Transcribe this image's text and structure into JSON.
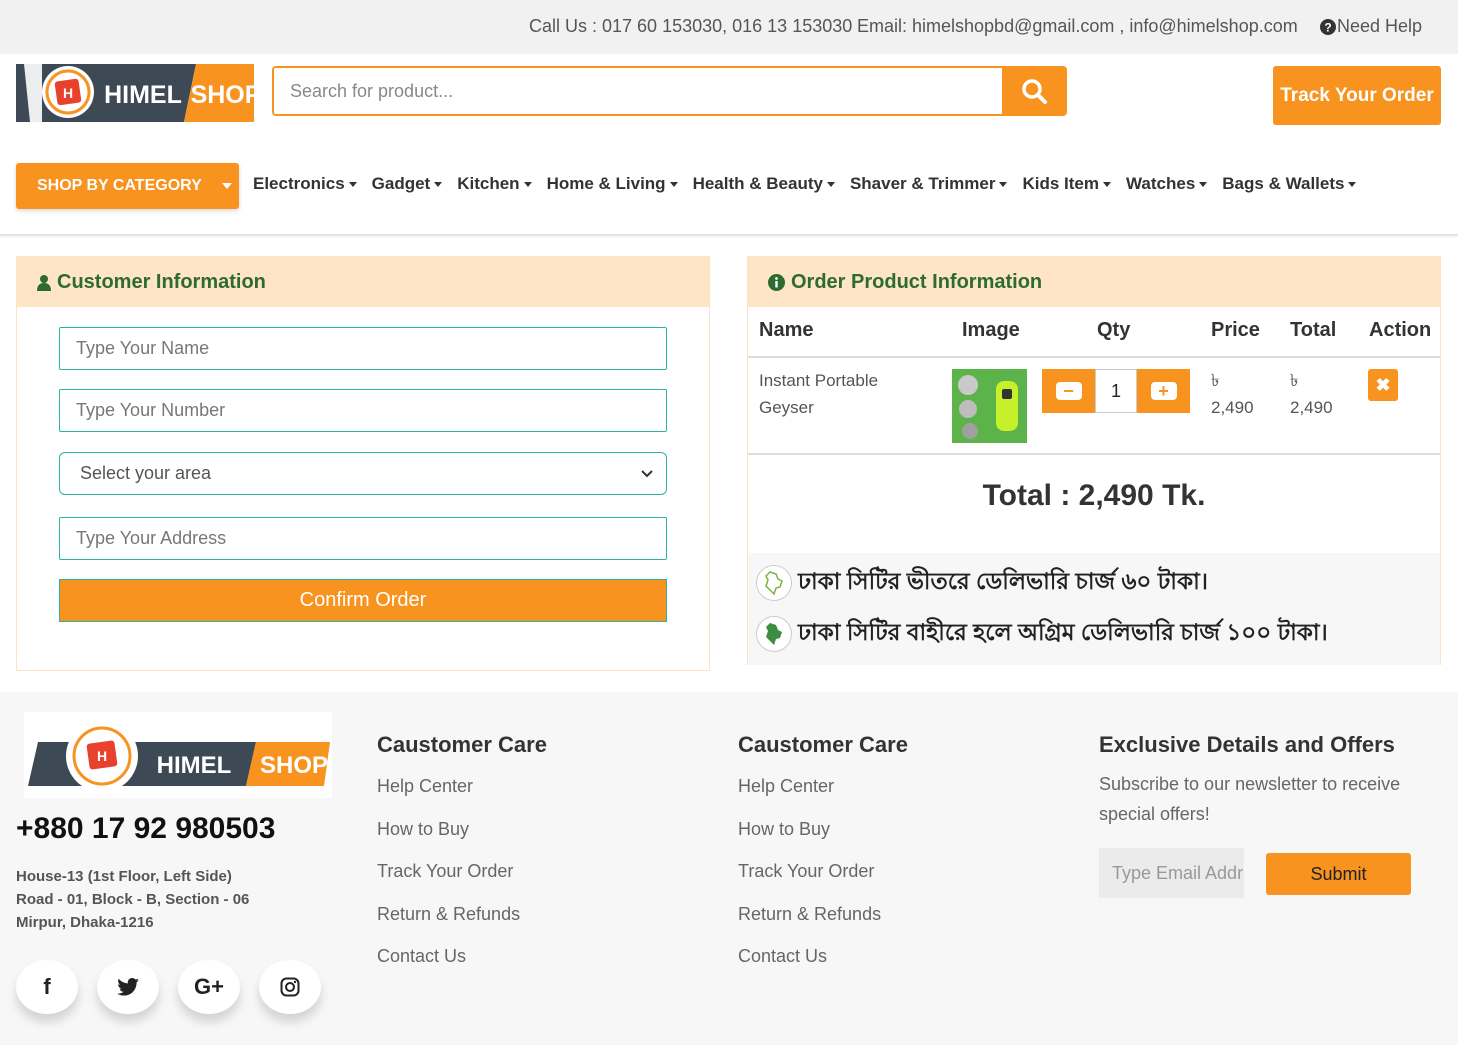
{
  "topbar": {
    "call": "Call Us : 017 60 153030, 016 13 153030",
    "email": "Email: himelshopbd@gmail.com , info@himelshop.com",
    "help": "Need Help"
  },
  "logo": {
    "left": "HIMEL",
    "right": "SHOP"
  },
  "search": {
    "placeholder": "Search for product..."
  },
  "header": {
    "track_order": "Track Your Order"
  },
  "nav": {
    "category_button": "SHOP BY CATEGORY",
    "items": [
      "Electronics",
      "Gadget",
      "Kitchen",
      "Home & Living",
      "Health & Beauty",
      "Shaver & Trimmer",
      "Kids Item",
      "Watches",
      "Bags & Wallets"
    ]
  },
  "customer": {
    "title": "Customer Information",
    "name_placeholder": "Type Your Name",
    "number_placeholder": "Type Your Number",
    "area_selected": "Select your area",
    "address_placeholder": "Type Your Address",
    "confirm": "Confirm Order"
  },
  "order": {
    "title": "Order Product Information",
    "headers": {
      "name": "Name",
      "image": "Image",
      "qty": "Qty",
      "price": "Price",
      "total": "Total",
      "action": "Action"
    },
    "item": {
      "name": "Instant Portable Geyser",
      "qty": "1",
      "currency": "৳",
      "price": "2,490",
      "total": "2,490"
    },
    "grand_total": "Total : 2,490 Tk.",
    "delivery_inside": "ঢাকা সিটির ভীতরে ডেলিভারি চার্জ ৬০ টাকা।",
    "delivery_outside": "ঢাকা সিটির বাহীরে হলে অগ্রিম ডেলিভারি চার্জ ১০০ টাকা।"
  },
  "footer": {
    "phone": "+880 17 92 980503",
    "address_line1": "House-13 (1st Floor, Left Side)",
    "address_line2": "Road - 01, Block - B, Section - 06",
    "address_line3": "Mirpur, Dhaka-1216",
    "col1": {
      "title": "Caustomer Care",
      "links": [
        "Help Center",
        "How to Buy",
        "Track Your Order",
        "Return & Refunds",
        "Contact Us"
      ]
    },
    "col2": {
      "title": "Caustomer Care",
      "links": [
        "Help Center",
        "How to Buy",
        "Track Your Order",
        "Return & Refunds",
        "Contact Us"
      ]
    },
    "newsletter": {
      "title": "Exclusive Details and Offers",
      "text": "Subscribe to our newsletter to receive special offers!",
      "email_placeholder": "Type Email Address",
      "submit": "Submit"
    },
    "social": {
      "facebook": "f",
      "google": "G+"
    }
  },
  "colors": {
    "accent": "#f7931e",
    "panel_head": "#fde5c6",
    "heading_green": "#2e6b2e",
    "field_border": "#2bb5a0"
  }
}
